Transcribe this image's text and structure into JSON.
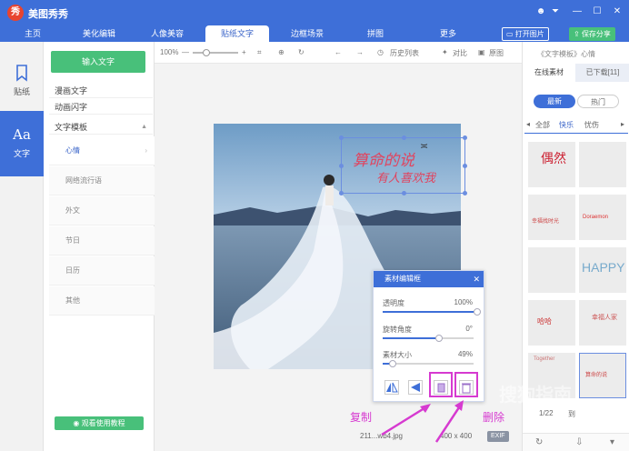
{
  "app": {
    "title": "美图秀秀",
    "logo_text": "秀"
  },
  "window_controls": [
    "☻",
    "⏷",
    "—",
    "☐",
    "✕"
  ],
  "main_tabs": [
    {
      "label": "主页"
    },
    {
      "label": "美化编辑"
    },
    {
      "label": "人像美容"
    },
    {
      "label": "贴纸文字"
    },
    {
      "label": "边框场景"
    },
    {
      "label": "拼图"
    },
    {
      "label": "更多"
    }
  ],
  "header_buttons": {
    "open": "打开图片",
    "save": "保存分享"
  },
  "left_nav": [
    {
      "label": "贴纸",
      "icon": "bookmark-icon"
    },
    {
      "label": "文字",
      "icon": "text-aa-icon"
    }
  ],
  "panel": {
    "input_button": "输入文字",
    "categories": [
      "漫画文字",
      "动画闪字",
      "文字模板"
    ],
    "subcategories": [
      "心情",
      "网络流行语",
      "外文",
      "节日",
      "日历",
      "其他"
    ],
    "tutorial_button": "观看使用教程"
  },
  "toolbar": {
    "zoom": "100%",
    "history": "历史列表",
    "compare": "对比",
    "original": "原图"
  },
  "sticker": {
    "line1": "算命的说",
    "line2": "有人喜欢我"
  },
  "file": {
    "name": "211...wb4.jpg",
    "size": "400 x 400",
    "exif": "EXIF"
  },
  "editor": {
    "title": "素材编辑框",
    "rows": [
      {
        "label": "透明度",
        "value": "100%",
        "fraction": 1.0
      },
      {
        "label": "旋转角度",
        "value": "0°",
        "fraction": 0.5
      },
      {
        "label": "素材大小",
        "value": "49%",
        "fraction": 0.1
      }
    ]
  },
  "annotations": {
    "copy": "复制",
    "delete": "删除"
  },
  "right_panel": {
    "tab_online": "在线素材",
    "tab_downloaded": "已下载[11]",
    "breadcrumb": "《文字模板》心情",
    "pill_new": "最新",
    "pill_hot": "热门",
    "sub_tabs": [
      "全部",
      "快乐",
      "忧伤"
    ],
    "thumbs": [
      "偶然",
      "",
      "幸福找时光",
      "Doraemon",
      "",
      "HAPPY",
      "哈哈",
      "幸福人家",
      "Together",
      "算命的说"
    ],
    "pager": "1/22",
    "pager_go": "到"
  },
  "watermark": "搜狗指南",
  "colors": {
    "brand": "#3e6fd8",
    "green": "#48c07a",
    "annotation": "#d63ad0",
    "sticker": "#e0445f"
  }
}
